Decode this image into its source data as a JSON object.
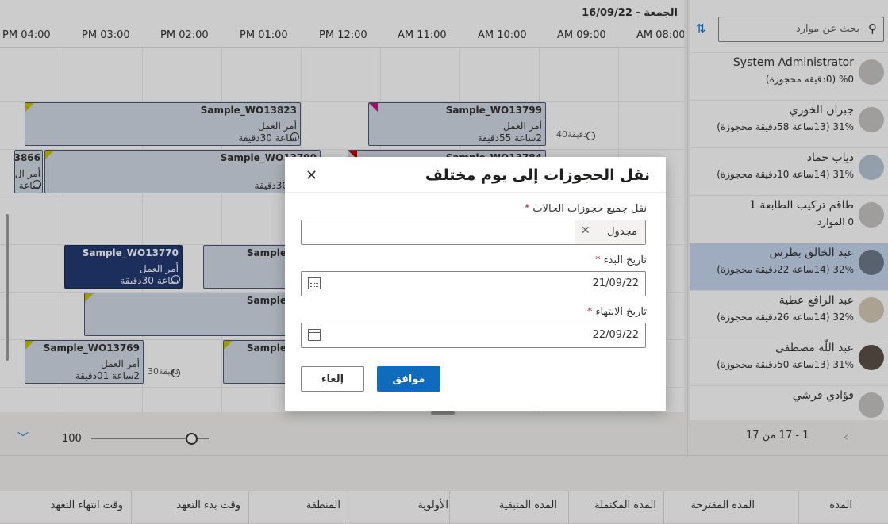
{
  "board": {
    "date_label": "الجمعة - 16/09/22",
    "hours": [
      "PM 04:00",
      "PM 03:00",
      "PM 02:00",
      "PM 01:00",
      "PM 12:00",
      "AM 11:00",
      "AM 10:00",
      "AM 09:00",
      "AM 08:00"
    ],
    "bookings": {
      "b1": {
        "title": "Sample_WO13823",
        "type": "أمر العمل",
        "duration": "ساعة 30دقيقة"
      },
      "b2": {
        "title": "Sample_WO13799",
        "type": "أمر العمل",
        "duration": "2ساعة 55دقيقة",
        "travel": "40دقيقة"
      },
      "b3": {
        "title": "3866",
        "type": "أمر ال",
        "duration": "ساعة"
      },
      "b4": {
        "title": "Sample_WO13790",
        "type": "",
        "duration": "30دقيقة"
      },
      "b5": {
        "title": "Sample_WO13784"
      },
      "b6": {
        "title": "Sample_WO13770",
        "type": "أمر العمل",
        "duration": "ساعة 30دقيقة"
      },
      "b7": {
        "title": "Sample"
      },
      "b8": {
        "title": "Sample"
      },
      "b9": {
        "title": "Sample_WO13769",
        "type": "أمر العمل",
        "duration": "2ساعة 01دقيقة",
        "travel": "30دقيقة"
      },
      "b10": {
        "title": "Sample"
      }
    },
    "zoom_value": "100"
  },
  "panel": {
    "search_placeholder": "بحث عن موارد",
    "resources": [
      {
        "name": "System Administrator",
        "stat": "%0 (0دقيقة محجوزة)"
      },
      {
        "name": "جبران الخوري",
        "stat": "31% (13ساعة 58دقيقة محجوزة)"
      },
      {
        "name": "دياب حماد",
        "stat": "31% (14ساعة 10دقيقة محجوزة)"
      },
      {
        "name": "طاقم تركيب الطابعة 1",
        "stat": "0 الموارد"
      },
      {
        "name": "عبد الخالق بطرس",
        "stat": "32% (14ساعة 22دقيقة محجوزة)"
      },
      {
        "name": "عبد الرافع عطية",
        "stat": "32% (14ساعة 26دقيقة محجوزة)"
      },
      {
        "name": "عبد اللّه مصطفى",
        "stat": "31% (13ساعة 50دقيقة محجوزة)"
      },
      {
        "name": "فؤادي قرشي",
        "stat": ""
      }
    ],
    "pager": "1 - 17 من 17"
  },
  "grid": {
    "columns": [
      "المدة",
      "المدة المقترحة",
      "المدة المكتملة",
      "المدة المتبقية",
      "الأولوية",
      "المنطقة",
      "وقت بدء التعهد",
      "وقت انتهاء التعهد"
    ]
  },
  "dialog": {
    "title": "نقل الحجوزات إلى يوم مختلف",
    "status_label": "نقل جميع حجوزات الحالات",
    "status_chip": "مجدول",
    "start_label": "تاريخ البدء",
    "start_value": "21/09/22",
    "end_label": "تاريخ الانتهاء",
    "end_value": "22/09/22",
    "required_mark": "*",
    "ok_label": "موافق",
    "cancel_label": "إلغاء"
  },
  "colors": {
    "accent": "#0f6cbd",
    "selected_row": "#c7d8ef",
    "booking": "#d4dbe6",
    "booking_dark": "#243a73"
  }
}
